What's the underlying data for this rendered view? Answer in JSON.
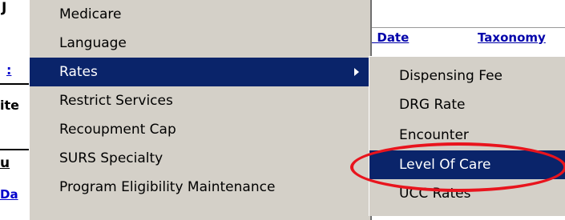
{
  "background": {
    "left_labels": [
      "J",
      "ite",
      "u",
      "Da"
    ],
    "link_fragment": ":",
    "column_headers": [
      "l Date",
      "Taxonomy"
    ]
  },
  "main_menu": {
    "items": [
      {
        "label": "Medicare"
      },
      {
        "label": "Language"
      },
      {
        "label": "Rates",
        "selected": true,
        "has_submenu": true
      },
      {
        "label": "Restrict Services"
      },
      {
        "label": "Recoupment Cap"
      },
      {
        "label": "SURS Specialty"
      },
      {
        "label": "Program Eligibility Maintenance"
      }
    ]
  },
  "rates_submenu": {
    "items": [
      {
        "label": "Dispensing Fee"
      },
      {
        "label": "DRG Rate"
      },
      {
        "label": "Encounter"
      },
      {
        "label": "Level Of Care",
        "selected": true
      },
      {
        "label": "UCC Rates"
      }
    ]
  },
  "annotation": {
    "type": "red-ellipse",
    "color": "#e8141d",
    "target": "Level Of Care"
  },
  "colors": {
    "menu_bg": "#d4d0c8",
    "selection_bg": "#0a246a",
    "link": "#0000aa"
  }
}
